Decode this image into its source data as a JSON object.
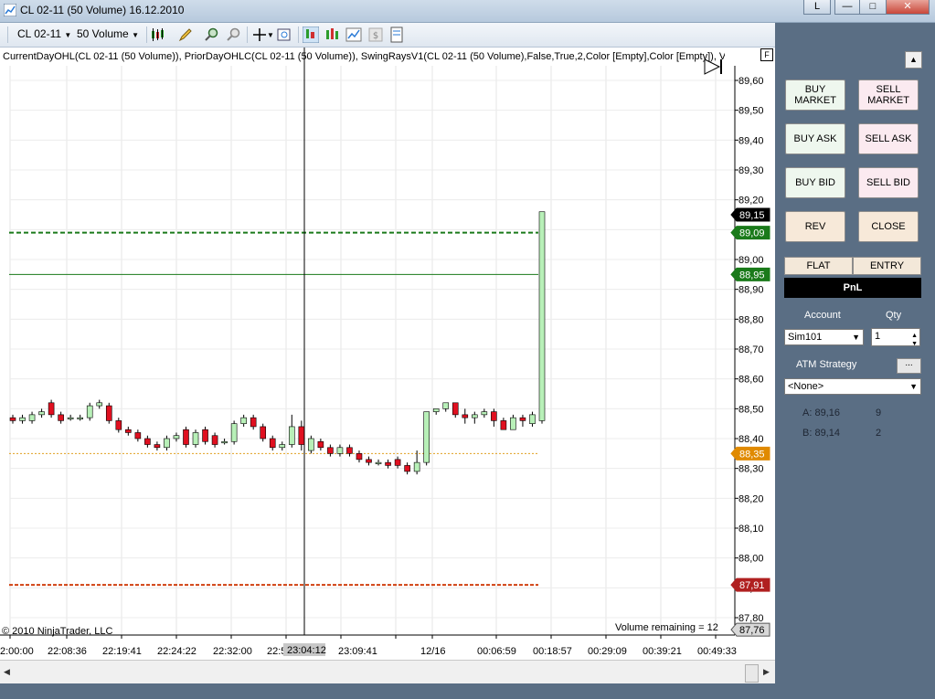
{
  "window": {
    "title": "CL 02-11 (50 Volume)  16.12.2010",
    "buttons": [
      "L",
      "—",
      "□",
      "✕"
    ]
  },
  "toolbar": {
    "instrument": "CL 02-11",
    "interval": "50 Volume"
  },
  "chart": {
    "indicator_text": "CurrentDayOHL(CL 02-11 (50 Volume)), PriorDayOHLC(CL 02-11 (50 Volume)), SwingRaysV1(CL 02-11 (50 Volume),False,True,2,Color [Empty],Color [Empty]), V",
    "corner_flag": "F",
    "copyright": "© 2010 NinjaTrader, LLC",
    "volume_remaining": "Volume remaining = 12",
    "y_ticks": [
      "89,60",
      "89,50",
      "89,40",
      "89,30",
      "89,20",
      "89,10",
      "89,00",
      "88,90",
      "88,80",
      "88,70",
      "88,60",
      "88,50",
      "88,40",
      "88,30",
      "88,20",
      "88,10",
      "88,00",
      "87,90",
      "87,80"
    ],
    "y_tick_values": [
      89.6,
      89.5,
      89.4,
      89.3,
      89.2,
      89.1,
      89.0,
      88.9,
      88.8,
      88.7,
      88.6,
      88.5,
      88.4,
      88.3,
      88.2,
      88.1,
      88.0,
      87.9,
      87.8
    ],
    "x_ticks": [
      "2:00:00",
      "22:08:36",
      "22:19:41",
      "22:24:22",
      "22:32:00",
      "22:5",
      "23:04:12",
      "23:09:41",
      "12/16",
      "00:06:59",
      "00:18:57",
      "00:29:09",
      "00:39:21",
      "00:49:33"
    ],
    "price_badges": [
      {
        "label": "89,15",
        "value": 89.15,
        "color": "#000000"
      },
      {
        "label": "89,09",
        "value": 89.09,
        "color": "#1a7a1a"
      },
      {
        "label": "88,95",
        "value": 88.95,
        "color": "#1a7a1a"
      },
      {
        "label": "88,35",
        "value": 88.35,
        "color": "#e08a00"
      },
      {
        "label": "87,91",
        "value": 87.91,
        "color": "#b02020"
      },
      {
        "label": "87,76",
        "value": 87.76,
        "color": "#d8d8d8"
      }
    ],
    "lines": {
      "dashed_green": 89.09,
      "solid_green": 88.95,
      "dotted_orange": 88.35,
      "dashed_red": 87.91
    },
    "bars": [
      [
        88.47,
        88.46,
        88.48,
        88.45
      ],
      [
        88.46,
        88.47,
        88.48,
        88.45
      ],
      [
        88.46,
        88.48,
        88.49,
        88.45
      ],
      [
        88.48,
        88.49,
        88.5,
        88.47
      ],
      [
        88.52,
        88.48,
        88.53,
        88.47
      ],
      [
        88.48,
        88.46,
        88.49,
        88.45
      ],
      [
        88.47,
        88.47,
        88.48,
        88.46
      ],
      [
        88.47,
        88.47,
        88.48,
        88.46
      ],
      [
        88.47,
        88.51,
        88.52,
        88.46
      ],
      [
        88.51,
        88.52,
        88.53,
        88.5
      ],
      [
        88.51,
        88.46,
        88.52,
        88.45
      ],
      [
        88.46,
        88.43,
        88.47,
        88.42
      ],
      [
        88.43,
        88.42,
        88.44,
        88.41
      ],
      [
        88.42,
        88.4,
        88.43,
        88.39
      ],
      [
        88.4,
        88.38,
        88.41,
        88.37
      ],
      [
        88.38,
        88.37,
        88.39,
        88.36
      ],
      [
        88.37,
        88.4,
        88.41,
        88.36
      ],
      [
        88.4,
        88.41,
        88.42,
        88.39
      ],
      [
        88.43,
        88.38,
        88.44,
        88.37
      ],
      [
        88.38,
        88.42,
        88.43,
        88.37
      ],
      [
        88.43,
        88.39,
        88.44,
        88.38
      ],
      [
        88.41,
        88.38,
        88.42,
        88.37
      ],
      [
        88.39,
        88.39,
        88.4,
        88.38
      ],
      [
        88.39,
        88.45,
        88.46,
        88.38
      ],
      [
        88.45,
        88.47,
        88.48,
        88.44
      ],
      [
        88.47,
        88.44,
        88.48,
        88.43
      ],
      [
        88.44,
        88.4,
        88.45,
        88.39
      ],
      [
        88.4,
        88.37,
        88.41,
        88.36
      ],
      [
        88.37,
        88.38,
        88.39,
        88.36
      ],
      [
        88.38,
        88.44,
        88.48,
        88.37
      ],
      [
        88.44,
        88.38,
        88.46,
        88.36
      ],
      [
        88.36,
        88.4,
        88.41,
        88.35
      ],
      [
        88.39,
        88.37,
        88.4,
        88.36
      ],
      [
        88.37,
        88.35,
        88.38,
        88.34
      ],
      [
        88.35,
        88.37,
        88.38,
        88.34
      ],
      [
        88.37,
        88.35,
        88.38,
        88.34
      ],
      [
        88.35,
        88.33,
        88.36,
        88.32
      ],
      [
        88.33,
        88.32,
        88.34,
        88.31
      ],
      [
        88.32,
        88.32,
        88.33,
        88.31
      ],
      [
        88.32,
        88.31,
        88.33,
        88.3
      ],
      [
        88.33,
        88.31,
        88.34,
        88.3
      ],
      [
        88.31,
        88.29,
        88.32,
        88.28
      ],
      [
        88.29,
        88.32,
        88.36,
        88.28
      ],
      [
        88.32,
        88.49,
        88.49,
        88.31
      ],
      [
        88.49,
        88.5,
        88.5,
        88.48
      ],
      [
        88.5,
        88.52,
        88.52,
        88.49
      ],
      [
        88.52,
        88.48,
        88.52,
        88.47
      ],
      [
        88.48,
        88.47,
        88.5,
        88.45
      ],
      [
        88.47,
        88.48,
        88.49,
        88.45
      ],
      [
        88.48,
        88.49,
        88.5,
        88.47
      ],
      [
        88.49,
        88.46,
        88.5,
        88.44
      ],
      [
        88.46,
        88.43,
        88.47,
        88.43
      ],
      [
        88.43,
        88.47,
        88.48,
        88.43
      ],
      [
        88.47,
        88.46,
        88.48,
        88.44
      ],
      [
        88.45,
        88.48,
        88.49,
        88.44
      ],
      [
        88.46,
        89.16,
        89.16,
        88.45
      ]
    ]
  },
  "panel": {
    "buy_market": "BUY MARKET",
    "sell_market": "SELL MARKET",
    "buy_ask": "BUY ASK",
    "sell_ask": "SELL ASK",
    "buy_bid": "BUY BID",
    "sell_bid": "SELL BID",
    "rev": "REV",
    "close": "CLOSE",
    "flat": "FLAT",
    "entry": "ENTRY",
    "pnl": "PnL",
    "account_label": "Account",
    "qty_label": "Qty",
    "account_value": "Sim101",
    "qty_value": "1",
    "atm_label": "ATM Strategy",
    "atm_value": "<None>",
    "ask_label": "A: 89,16",
    "ask_size": "9",
    "bid_label": "B: 89,14",
    "bid_size": "2"
  }
}
